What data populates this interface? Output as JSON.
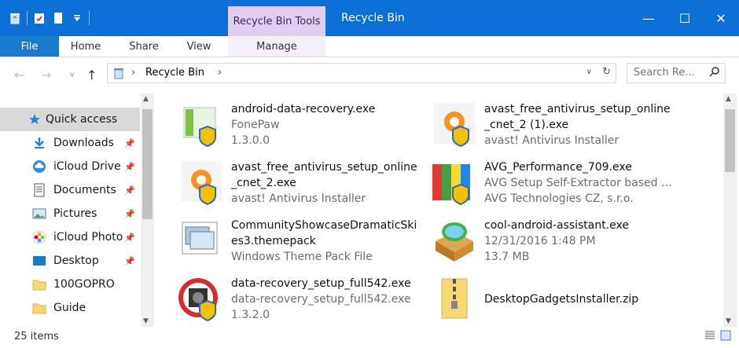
{
  "titlebar": {
    "context_tab": "Recycle Bin Tools",
    "title": "Recycle Bin"
  },
  "ribbon": {
    "tabs": [
      "File",
      "Home",
      "Share",
      "View",
      "Manage"
    ]
  },
  "address": {
    "crumb": "Recycle Bin",
    "search_placeholder": "Search Re..."
  },
  "nav": {
    "items": [
      {
        "label": "Quick access",
        "icon": "star-icon",
        "pinned": false,
        "selected": true
      },
      {
        "label": "Downloads",
        "icon": "download-arrow-icon",
        "pinned": true
      },
      {
        "label": "iCloud Drive",
        "icon": "cloud-icon",
        "pinned": true
      },
      {
        "label": "Documents",
        "icon": "document-icon",
        "pinned": true
      },
      {
        "label": "Pictures",
        "icon": "pictures-icon",
        "pinned": true
      },
      {
        "label": "iCloud Photo",
        "icon": "photos-icon",
        "pinned": true
      },
      {
        "label": "Desktop",
        "icon": "desktop-icon",
        "pinned": true
      },
      {
        "label": "100GOPRO",
        "icon": "folder-icon",
        "pinned": false
      },
      {
        "label": "Guide",
        "icon": "folder-icon",
        "pinned": false
      }
    ]
  },
  "files": [
    {
      "name": "android-data-recovery.exe",
      "line2": "FonePaw",
      "line3": "1.3.0.0",
      "icon": "installer-green-icon"
    },
    {
      "name": "avast_free_antivirus_setup_online_cnet_2 (1).exe",
      "line2": "",
      "line3": "avast! Antivirus Installer",
      "icon": "avast-icon"
    },
    {
      "name": "avast_free_antivirus_setup_online_cnet_2.exe",
      "line2": "",
      "line3": "avast! Antivirus Installer",
      "icon": "avast-icon"
    },
    {
      "name": "AVG_Performance_709.exe",
      "line2": "AVG Setup Self-Extractor based o...",
      "line3": "AVG Technologies CZ, s.r.o.",
      "icon": "avg-icon"
    },
    {
      "name": "CommunityShowcaseDramaticSkies3.themepack",
      "line2": "",
      "line3": "Windows Theme Pack File",
      "icon": "themepack-icon"
    },
    {
      "name": "cool-android-assistant.exe",
      "line2": "12/31/2016 1:48 PM",
      "line3": "13.7 MB",
      "icon": "android-assistant-icon"
    },
    {
      "name": "data-recovery_setup_full542.exe",
      "line2": "data-recovery_setup_full542.exe",
      "line3": "1.3.2.0",
      "icon": "data-recovery-icon"
    },
    {
      "name": "DesktopGadgetsInstaller.zip",
      "line2": "",
      "line3": "",
      "icon": "zip-folder-icon"
    }
  ],
  "status": {
    "count": "25 items"
  },
  "colors": {
    "titlebar": "#0b6fd6",
    "context_tab": "#e0cdf0",
    "file_tab": "#1979ca"
  }
}
